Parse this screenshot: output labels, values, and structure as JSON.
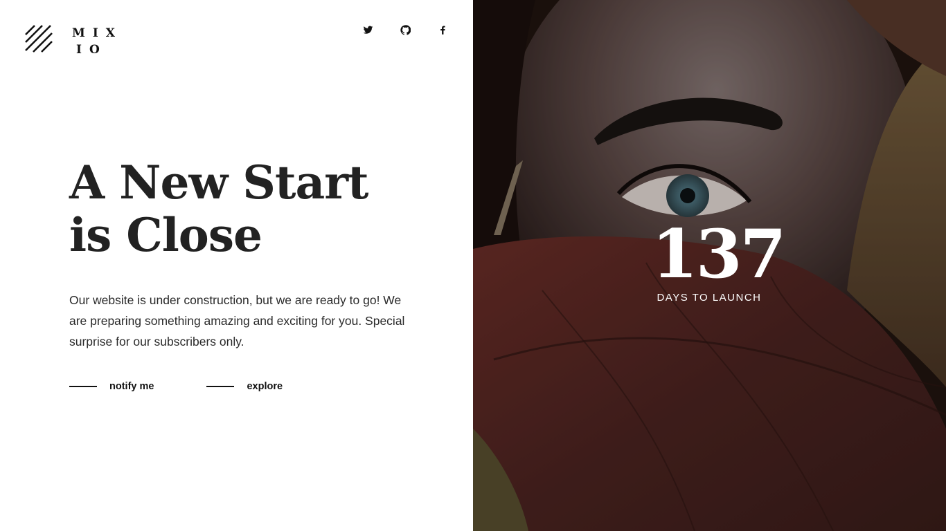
{
  "brand": {
    "name_line1": "MIX",
    "name_line2": "IO",
    "logo_icon": "diagonal-stripes-logo"
  },
  "social": [
    {
      "name": "twitter",
      "icon": "twitter-icon"
    },
    {
      "name": "github",
      "icon": "github-icon"
    },
    {
      "name": "facebook",
      "icon": "facebook-icon"
    }
  ],
  "hero": {
    "title_line1": "A New Start",
    "title_line2": "is Close",
    "description": "Our website is under construction, but we are ready to go! We are preparing something amazing and exciting for you. Special surprise for our subscribers only."
  },
  "actions": {
    "notify_label": "notify me",
    "explore_label": "explore"
  },
  "countdown": {
    "value": "137",
    "label": "DAYS TO LAUNCH"
  },
  "colors": {
    "text_dark": "#222222",
    "background_left": "#ffffff",
    "image_tone": "#5a2a22",
    "overlay_text": "#ffffff"
  }
}
